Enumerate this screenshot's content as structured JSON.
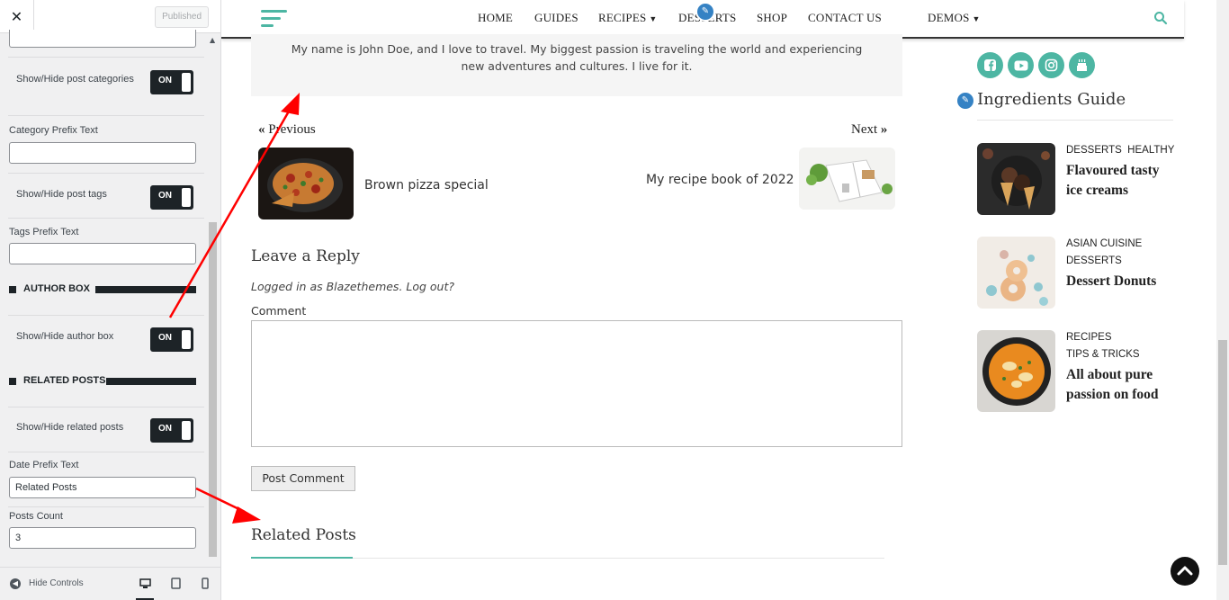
{
  "customizer": {
    "close_icon": "close-icon",
    "publish_label": "Published",
    "controls": {
      "post_categories_label": "Show/Hide post categories",
      "post_categories_toggle": "ON",
      "category_prefix_label": "Category Prefix Text",
      "category_prefix_value": "",
      "post_tags_label": "Show/Hide post tags",
      "post_tags_toggle": "ON",
      "tags_prefix_label": "Tags Prefix Text",
      "tags_prefix_value": "",
      "author_box_heading": "AUTHOR BOX",
      "author_box_label": "Show/Hide author box",
      "author_box_toggle": "ON",
      "related_posts_heading": "RELATED POSTS",
      "related_posts_label": "Show/Hide related posts",
      "related_posts_toggle": "ON",
      "date_prefix_label": "Date Prefix Text",
      "date_prefix_value": "Related Posts",
      "posts_count_label": "Posts Count",
      "posts_count_value": "3"
    },
    "footer": {
      "hide_controls_label": "Hide Controls",
      "devices": [
        "desktop-icon",
        "tablet-icon",
        "mobile-icon"
      ]
    }
  },
  "nav": {
    "items": [
      "HOME",
      "GUIDES",
      "RECIPES",
      "DESSERTS",
      "SHOP",
      "CONTACT US",
      "DEMOS"
    ],
    "accent_color": "#4db6a3"
  },
  "author_box": {
    "bio": "My name is John Doe, and I love to travel. My biggest passion is traveling the world and experiencing new adventures and cultures. I live for it."
  },
  "post_nav": {
    "previous_label": "Previous",
    "next_label": "Next",
    "previous_title": "Brown pizza special",
    "next_title": "My recipe book of 2022"
  },
  "comments": {
    "heading": "Leave a Reply",
    "logged_in_text": "Logged in as Blazethemes. Log out?",
    "comment_label": "Comment",
    "submit_label": "Post Comment"
  },
  "related": {
    "heading": "Related Posts"
  },
  "sidebar": {
    "widget_title": "Ingredients Guide",
    "social_icons": [
      "facebook-icon",
      "youtube-icon",
      "instagram-icon",
      "cake-icon"
    ],
    "posts": [
      {
        "categories": [
          "DESSERTS",
          "HEALTHY"
        ],
        "title": "Flavoured tasty ice creams"
      },
      {
        "categories": [
          "ASIAN CUISINE",
          "DESSERTS"
        ],
        "title": "Dessert Donuts"
      },
      {
        "categories": [
          "RECIPES",
          "TIPS & TRICKS"
        ],
        "title": "All about pure passion on food"
      }
    ]
  }
}
